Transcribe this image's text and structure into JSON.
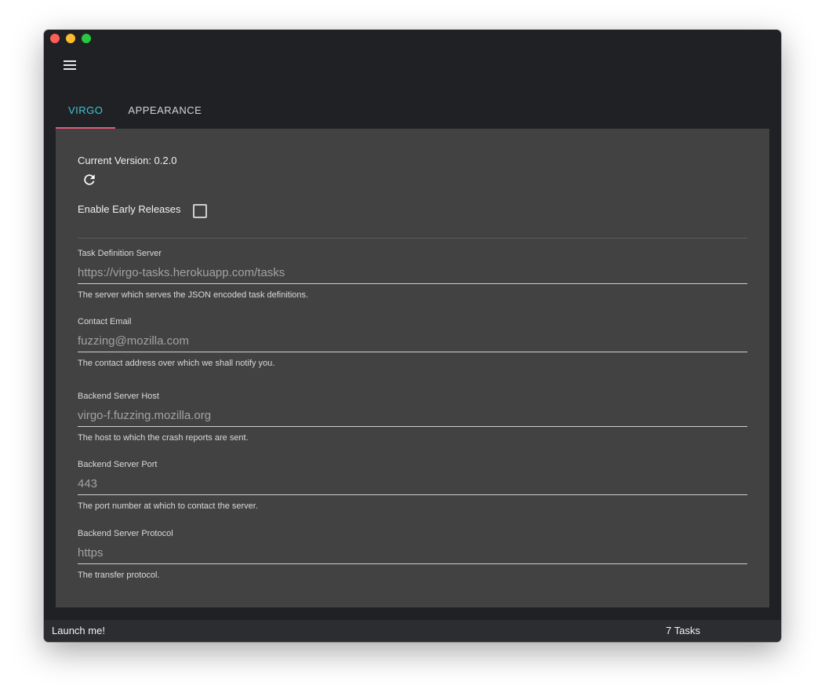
{
  "tabs": [
    {
      "label": "VIRGO",
      "active": true
    },
    {
      "label": "APPEARANCE",
      "active": false
    }
  ],
  "version": {
    "text": "Current Version: 0.2.0"
  },
  "early_releases": {
    "label": "Enable Early Releases",
    "checked": false
  },
  "fields": [
    {
      "label": "Task Definition Server",
      "value": "https://virgo-tasks.herokuapp.com/tasks",
      "help": "The server which serves the JSON encoded task definitions."
    },
    {
      "label": "Contact Email",
      "value": "fuzzing@mozilla.com",
      "help": "The contact address over which we shall notify you."
    },
    {
      "label": "Backend Server Host",
      "value": "virgo-f.fuzzing.mozilla.org",
      "help": "The host to which the crash reports are sent."
    },
    {
      "label": "Backend Server Port",
      "value": "443",
      "help": "The port number at which to contact the server."
    },
    {
      "label": "Backend Server Protocol",
      "value": "https",
      "help": "The transfer protocol."
    }
  ],
  "statusbar": {
    "launch": "Launch me!",
    "tasks": "7 Tasks"
  },
  "icons": {
    "menu": "menu-icon",
    "refresh": "refresh-icon"
  },
  "colors": {
    "accent": "#3ec4d6",
    "tab_indicator": "#e8577a",
    "panel": "#424242",
    "window": "#202124"
  }
}
